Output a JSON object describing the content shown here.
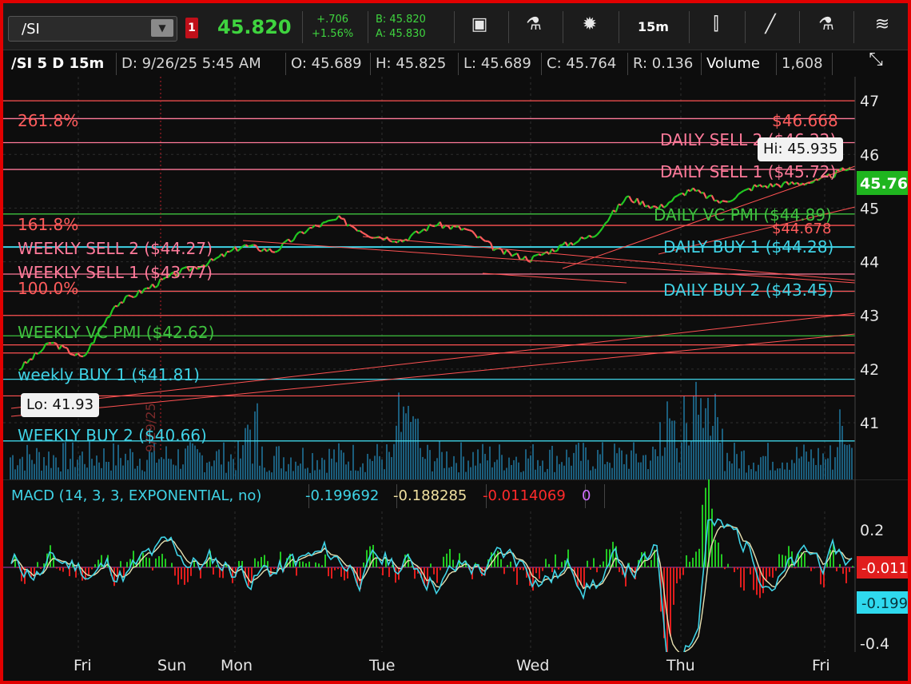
{
  "toolbar": {
    "symbol": "/SI",
    "flag": "1",
    "last": "45.820",
    "change": "+.706",
    "change_pct": "+1.56%",
    "bid": "B: 45.820",
    "ask": "A: 45.830",
    "interval": "15m"
  },
  "infobar": {
    "title": "/SI 5 D 15m",
    "date": "D: 9/26/25 5:45 AM",
    "open": "O: 45.689",
    "high": "H: 45.825",
    "low": "L: 45.689",
    "close": "C: 45.764",
    "range": "R: 0.136",
    "volume_label": "Volume",
    "volume": "1,608"
  },
  "price_axis": {
    "ticks": [
      "47",
      "46",
      "45",
      "44",
      "43",
      "42",
      "41"
    ],
    "current_tag": "45.764",
    "hi_tag": "Hi: 45.935",
    "lo_tag": "Lo: 41.93"
  },
  "levels": {
    "fib_2618": "261.8%",
    "fib_1618": "161.8%",
    "fib_100": "100.0%",
    "fib_price": "$46.668",
    "fib_1618_price": "$44.678",
    "daily_sell_2": "DAILY SELL 2 ($46.22)",
    "daily_sell_1": "DAILY SELL 1 ($45.72)",
    "daily_vc_pmi": "DAILY VC PMI ($44.89)",
    "daily_buy_1": "DAILY BUY 1 ($44.28)",
    "daily_buy_2": "DAILY BUY 2 ($43.45)",
    "weekly_sell_2": "WEEKLY SELL 2 ($44.27)",
    "weekly_sell_1": "WEEKLY SELL 1 ($43.77)",
    "weekly_vc_pmi": "WEEKLY VC PMI ($42.62)",
    "weekly_buy_1": "weekly BUY 1 ($41.81)",
    "weekly_buy_2": "WEEKLY BUY 2 ($40.66)",
    "date_marker": "9/29/25"
  },
  "macd": {
    "title": "MACD (14, 3, 3, EXPONENTIAL, no)",
    "value": "-0.199692",
    "avg": "-0.188285",
    "diff": "-0.0114069",
    "zero": "0",
    "ticks": [
      "0.2",
      "-0.4"
    ],
    "tag_diff": "-0.011",
    "tag_value": "-0.199"
  },
  "xaxis": [
    "Fri",
    "Sun",
    "Mon",
    "Tue",
    "Wed",
    "Thu",
    "Fri"
  ],
  "colors": {
    "up": "#22c822",
    "down": "#ff5c5c",
    "cyan": "#3fd3e6",
    "green_level": "#3fc23f",
    "red_level": "#ff5252",
    "pink_level": "#ff7a9a"
  },
  "chart_data": {
    "type": "line",
    "title": "/SI 5 D 15m",
    "xlabel": "",
    "ylabel": "",
    "ylim": [
      40.3,
      47.3
    ],
    "x": [
      "Fri",
      "Sun",
      "Mon",
      "Tue",
      "Wed",
      "Thu",
      "Fri"
    ],
    "series": [
      {
        "values": [
          42.0,
          42.5,
          42.2,
          43.2,
          43.5,
          43.8,
          44.0,
          44.3,
          44.2,
          44.6,
          44.8,
          44.5,
          44.4,
          44.7,
          44.6,
          44.2,
          44.05,
          44.3,
          44.5,
          45.2,
          45.0,
          45.35,
          45.1,
          45.4,
          45.45,
          45.5,
          45.76
        ]
      }
    ],
    "levels": [
      46.668,
      46.22,
      45.72,
      44.89,
      44.678,
      44.28,
      44.27,
      43.77,
      43.45,
      42.62,
      41.81,
      40.66
    ],
    "macd_ylim": [
      -0.43,
      0.28
    ]
  }
}
